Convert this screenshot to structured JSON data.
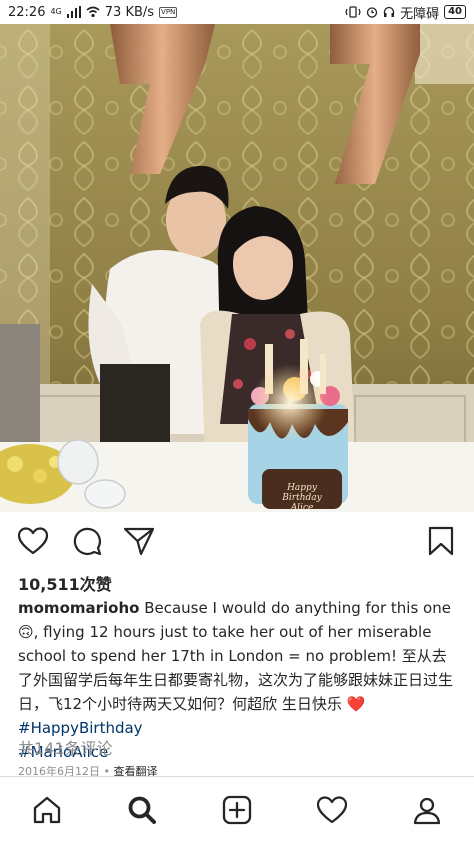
{
  "status_bar": {
    "time": "22:26",
    "network_type": "4G",
    "net_speed": "73 KB/s",
    "vpn_label": "VPN",
    "accessibility_label": "无障碍",
    "battery": "40"
  },
  "post": {
    "likes": "10,511次赞",
    "username": "momomarioho",
    "caption_text": " Because I would do anything for this one 🙃, flying 12 hours just to take her out of her miserable school to spend her 17th in London = no problem! 至从去了外国留学后每年生日都要寄礼物，这次为了能够跟妹妹正日过生日，飞12个小时待两天又如何？何超欣 生日快乐 ",
    "heart_emoji": "❤️",
    "hashtags": [
      "#HappyBirthday",
      "#MarioAlice"
    ],
    "comments_link": "共141条评论",
    "date": "2016年6月12日",
    "separator": " • ",
    "translate_label": "查看翻译"
  },
  "photo": {
    "cake_text_line1": "Happy",
    "cake_text_line2": "Birthday",
    "cake_text_line3": "Alice",
    "balloon_digits": "17"
  },
  "icons": {
    "like": "heart-icon",
    "comment": "comment-icon",
    "share": "share-icon",
    "save": "bookmark-icon",
    "nav": [
      "home-icon",
      "search-icon",
      "add-icon",
      "activity-heart-icon",
      "profile-icon"
    ]
  },
  "colors": {
    "hashtag": "#003569",
    "secondary_text": "#8e8e8e",
    "heart": "#e0245e"
  }
}
